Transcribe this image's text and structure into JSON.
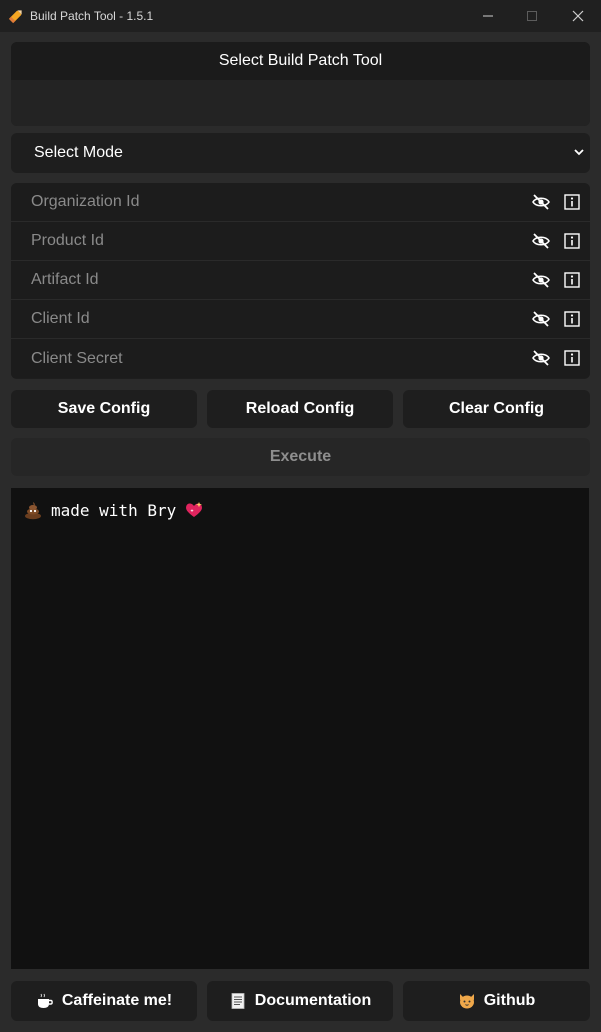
{
  "window": {
    "title": "Build Patch Tool - 1.5.1",
    "min_glyph": "—",
    "close_glyph": "✕"
  },
  "tool_panel": {
    "header": "Select Build Patch Tool"
  },
  "mode_select": {
    "selected": "Select Mode"
  },
  "fields": [
    {
      "placeholder": "Organization Id"
    },
    {
      "placeholder": "Product Id"
    },
    {
      "placeholder": "Artifact Id"
    },
    {
      "placeholder": "Client Id"
    },
    {
      "placeholder": "Client Secret"
    }
  ],
  "actions": {
    "save": "Save Config",
    "reload": "Reload Config",
    "clear": "Clear Config",
    "execute": "Execute"
  },
  "console": {
    "message": "made with Bry"
  },
  "footer": {
    "coffee": "Caffeinate me!",
    "docs": "Documentation",
    "github": "Github"
  },
  "icons": {
    "app": "pencil-icon",
    "eye": "eye-slash-icon",
    "info": "info-icon",
    "console_prefix": "poop-emoji-icon",
    "console_suffix": "sparkling-heart-icon",
    "coffee": "coffee-icon",
    "docs": "document-icon",
    "github": "cat-icon"
  },
  "colors": {
    "window_bg": "#2b2b2b",
    "panel_bg": "#1e1e1e",
    "console_bg": "#111111",
    "disabled_text": "#8e8e8e"
  }
}
